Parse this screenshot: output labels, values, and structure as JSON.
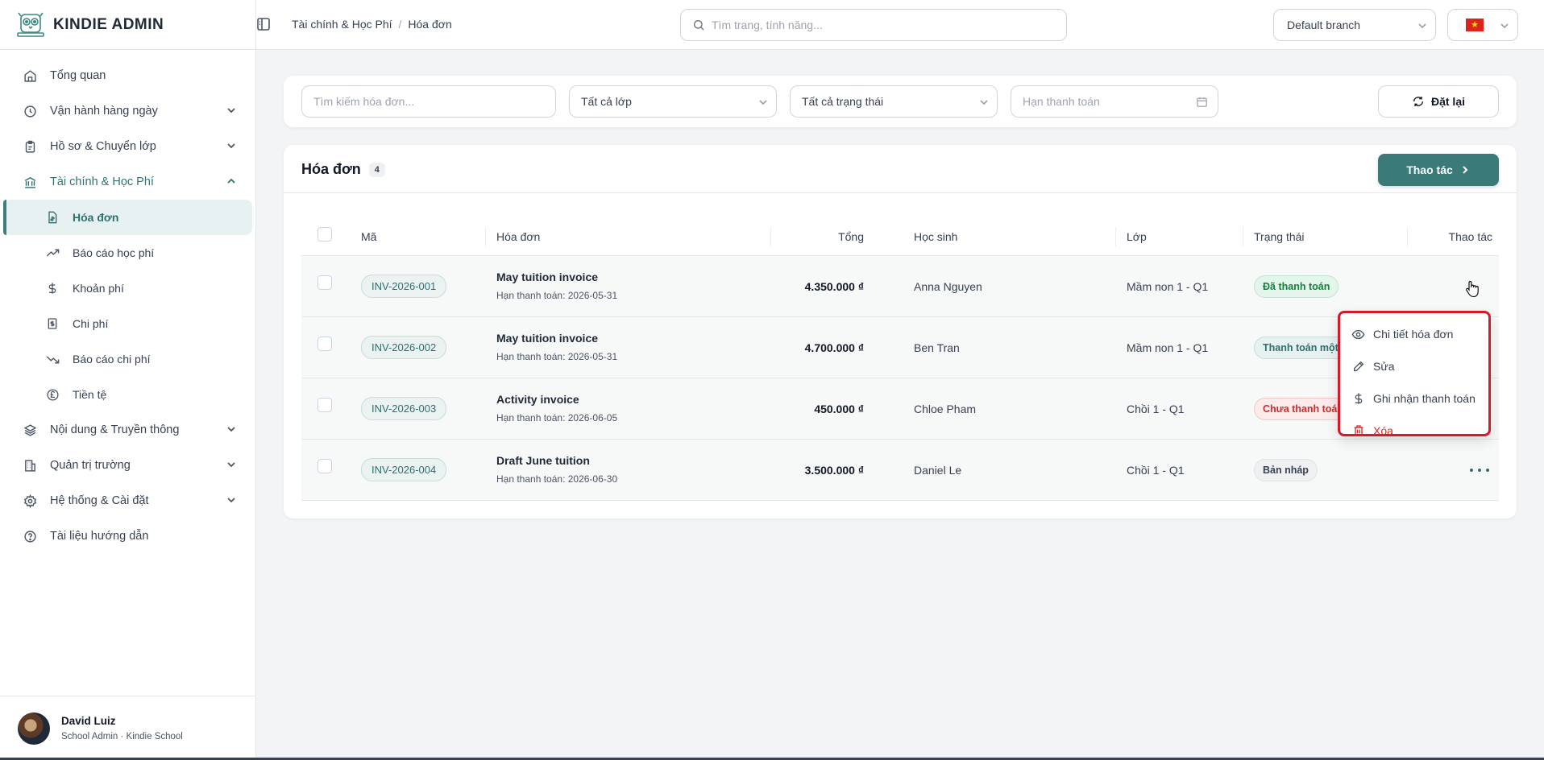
{
  "brand": {
    "name": "KINDIE ADMIN"
  },
  "sidebar": {
    "items": [
      {
        "label": "Tổng quan"
      },
      {
        "label": "Vận hành hàng ngày"
      },
      {
        "label": "Hồ sơ & Chuyển lớp"
      },
      {
        "label": "Tài chính & Học Phí"
      },
      {
        "label": "Nội dung & Truyền thông"
      },
      {
        "label": "Quản trị trường"
      },
      {
        "label": "Hệ thống & Cài đặt"
      },
      {
        "label": "Tài liệu hướng dẫn"
      }
    ],
    "sub_items": [
      {
        "label": "Hóa đơn"
      },
      {
        "label": "Báo cáo học phí"
      },
      {
        "label": "Khoản phí"
      },
      {
        "label": "Chi phí"
      },
      {
        "label": "Báo cáo chi phí"
      },
      {
        "label": "Tiền tệ"
      }
    ],
    "active_sub": "Hóa đơn"
  },
  "user": {
    "name": "David Luiz",
    "role": "School Admin · Kindie School"
  },
  "header": {
    "breadcrumb": [
      "Tài chính & Học Phí",
      "Hóa đơn"
    ],
    "breadcrumb_sep": "/",
    "search_placeholder": "Tìm trang, tính năng...",
    "branch": "Default branch",
    "language_flag": "vn-flag"
  },
  "filters": {
    "search_placeholder": "Tìm kiếm hóa đơn...",
    "class_select": "Tất cả lớp",
    "status_select": "Tất cả trạng thái",
    "due_placeholder": "Hạn thanh toán",
    "reset_label": "Đặt lại"
  },
  "invoices": {
    "title": "Hóa đơn",
    "count": "4",
    "actions_label": "Thao tác",
    "columns": [
      "Mã",
      "Hóa đơn",
      "Tổng",
      "Học sinh",
      "Lớp",
      "Trạng thái",
      "Thao tác"
    ],
    "rows": [
      {
        "code": "INV-2026-001",
        "name": "May tuition invoice",
        "due": "Hạn thanh toán: 2026-05-31",
        "total": "4.350.000 ₫",
        "student": "Anna Nguyen",
        "class": "Mầm non 1 - Q1",
        "status": "Đã thanh toán",
        "status_type": "paid"
      },
      {
        "code": "INV-2026-002",
        "name": "May tuition invoice",
        "due": "Hạn thanh toán: 2026-05-31",
        "total": "4.700.000 ₫",
        "student": "Ben Tran",
        "class": "Mầm non 1 - Q1",
        "status": "Thanh toán một phần",
        "status_type": "partial"
      },
      {
        "code": "INV-2026-003",
        "name": "Activity invoice",
        "due": "Hạn thanh toán: 2026-06-05",
        "total": "450.000 ₫",
        "student": "Chloe Pham",
        "class": "Chồi 1 - Q1",
        "status": "Chưa thanh toán",
        "status_type": "unpaid"
      },
      {
        "code": "INV-2026-004",
        "name": "Draft June tuition",
        "due": "Hạn thanh toán: 2026-06-30",
        "total": "3.500.000 ₫",
        "student": "Daniel Le",
        "class": "Chồi 1 - Q1",
        "status": "Bản nháp",
        "status_type": "draft"
      }
    ]
  },
  "row_menu": {
    "items": [
      {
        "label": "Chi tiết hóa đơn",
        "icon": "eye-icon"
      },
      {
        "label": "Sửa",
        "icon": "pencil-icon"
      },
      {
        "label": "Ghi nhận thanh toán",
        "icon": "dollar-icon"
      },
      {
        "label": "Xóa",
        "icon": "trash-icon"
      }
    ]
  },
  "colors": {
    "accent": "#3a7a78",
    "danger": "#dc2626",
    "highlight": "#d11d2a"
  }
}
